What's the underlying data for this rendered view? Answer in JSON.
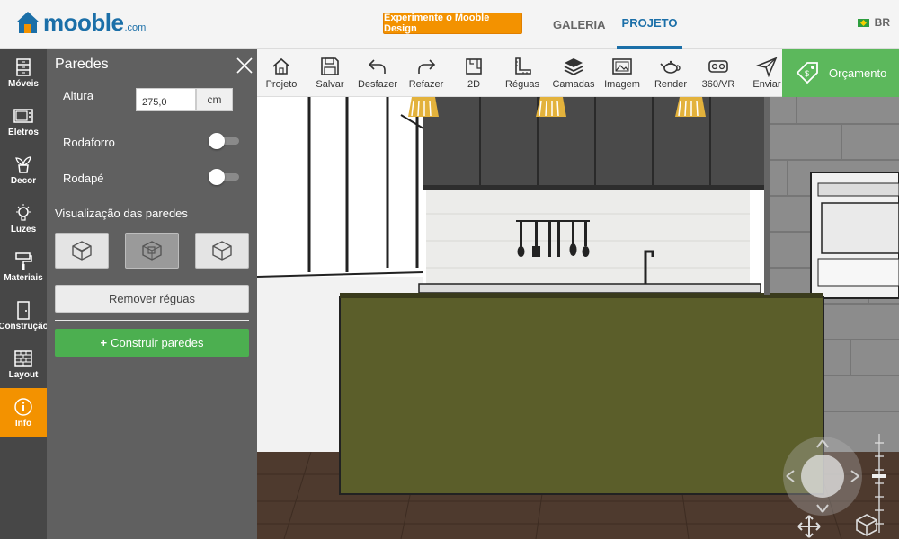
{
  "header": {
    "logo_text": "mooble",
    "logo_suffix": ".com",
    "promo_button": "Experimente o Mooble Design",
    "tabs": [
      {
        "label": "GALERIA",
        "active": false
      },
      {
        "label": "PROJETO",
        "active": true
      }
    ],
    "language": "BR"
  },
  "sidebar": {
    "items": [
      {
        "label": "Móveis",
        "icon": "dresser-icon"
      },
      {
        "label": "Eletros",
        "icon": "microwave-icon"
      },
      {
        "label": "Decor",
        "icon": "plant-icon"
      },
      {
        "label": "Luzes",
        "icon": "lightbulb-icon"
      },
      {
        "label": "Materiais",
        "icon": "paint-roller-icon"
      },
      {
        "label": "Construção",
        "icon": "door-icon"
      },
      {
        "label": "Layout",
        "icon": "brick-wall-icon"
      },
      {
        "label": "Info",
        "icon": "info-icon",
        "active": true
      }
    ]
  },
  "panel": {
    "title": "Paredes",
    "height_label": "Altura",
    "height_value": "275,0",
    "height_unit": "cm",
    "rodaforro_label": "Rodaforro",
    "rodaforro_on": false,
    "rodape_label": "Rodapé",
    "rodape_on": false,
    "visualization_label": "Visualização das paredes",
    "view_modes": [
      "walls-cube-icon",
      "walls-cut-icon",
      "walls-hidden-icon"
    ],
    "remove_button": "Remover réguas",
    "build_button": "Construir paredes",
    "build_icon": "+"
  },
  "toolbar": {
    "tools": [
      {
        "label": "Projeto",
        "icon": "home-icon"
      },
      {
        "label": "Salvar",
        "icon": "save-icon"
      },
      {
        "label": "Desfazer",
        "icon": "undo-icon"
      },
      {
        "label": "Refazer",
        "icon": "redo-icon"
      },
      {
        "label": "2D",
        "icon": "plan-2d-icon"
      },
      {
        "label": "Réguas",
        "icon": "ruler-icon"
      },
      {
        "label": "Camadas",
        "icon": "layers-icon"
      },
      {
        "label": "Imagem",
        "icon": "image-icon"
      },
      {
        "label": "Render",
        "icon": "teapot-icon"
      },
      {
        "label": "360/VR",
        "icon": "vr-icon"
      },
      {
        "label": "Enviar",
        "icon": "send-icon"
      }
    ],
    "quote_button": "Orçamento",
    "quote_icon": "price-tag-icon"
  },
  "colors": {
    "brand_blue": "#1b6fa8",
    "orange": "#f39200",
    "green": "#5cb85c",
    "panel_gray": "#606060",
    "iconbar_gray": "#474747",
    "island_olive": "#5b5e2a"
  }
}
